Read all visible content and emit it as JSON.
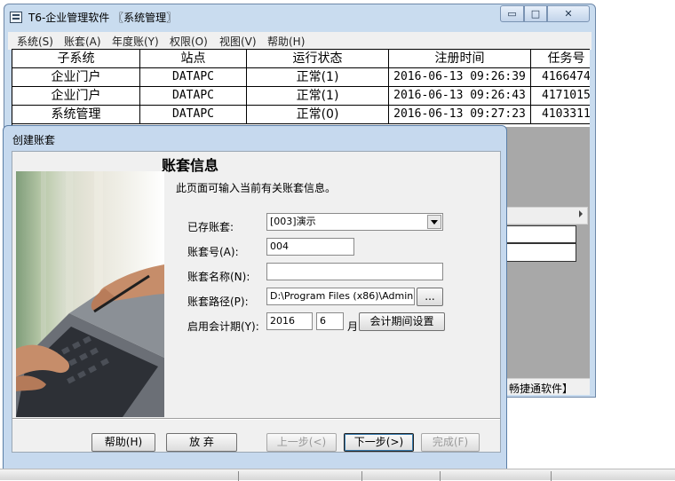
{
  "main_window": {
    "title": "T6-企业管理软件 〖系统管理〗",
    "controls": {
      "minimize": "▭",
      "maximize": "□",
      "close": "✕"
    },
    "menu": [
      "系统(S)",
      "账套(A)",
      "年度账(Y)",
      "权限(O)",
      "视图(V)",
      "帮助(H)"
    ],
    "table": {
      "headers": [
        "子系统",
        "站点",
        "运行状态",
        "注册时间",
        "任务号"
      ],
      "rows": [
        [
          "企业门户",
          "DATAPC",
          "正常(1)",
          "2016-06-13 09:26:39",
          "4166474"
        ],
        [
          "企业门户",
          "DATAPC",
          "正常(1)",
          "2016-06-13 09:26:43",
          "4171015"
        ],
        [
          "系统管理",
          "DATAPC",
          "正常(0)",
          "2016-06-13 09:27:23",
          "4103311"
        ]
      ]
    },
    "status_text": "畅捷通软件】"
  },
  "dialog": {
    "title": "创建账套",
    "heading": "账套信息",
    "description": "此页面可输入当前有关账套信息。",
    "fields": {
      "existing_label": "已存账套:",
      "existing_value": "[003]演示",
      "number_label": "账套号(A):",
      "number_value": "004",
      "name_label": "账套名称(N):",
      "name_value": "",
      "path_label": "账套路径(P):",
      "path_value": "D:\\Program Files (x86)\\Admin",
      "browse_label": "...",
      "period_label": "启用会计期(Y):",
      "year_value": "2016",
      "month_value": "6",
      "month_unit": "月",
      "period_button": "会计期间设置"
    },
    "buttons": {
      "help": "帮助(H)",
      "abandon": "放 弃",
      "prev": "上一步(<)",
      "next": "下一步(>)",
      "finish": "完成(F)"
    }
  }
}
